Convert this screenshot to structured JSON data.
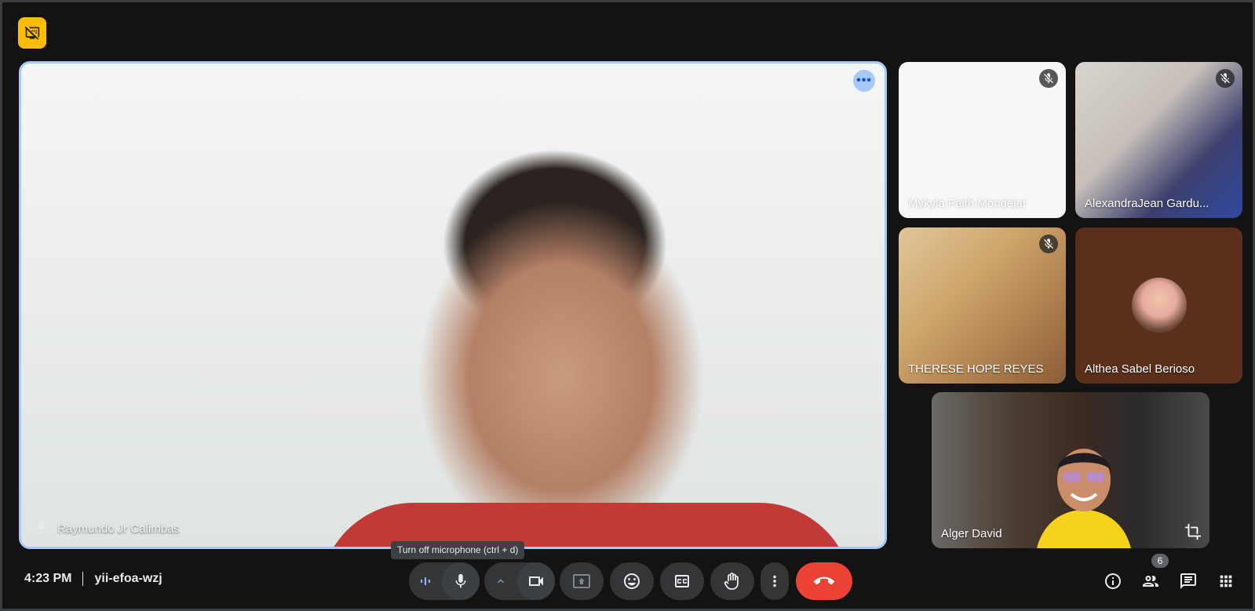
{
  "meeting": {
    "time": "4:23 PM",
    "code": "yii-efoa-wzj"
  },
  "main_tile": {
    "participant": "Raymundo Jr Calimbas"
  },
  "participants": [
    {
      "name": "Mykyla Faith Mondejar",
      "muted": true
    },
    {
      "name": "AlexandraJean Gardu...",
      "muted": true
    },
    {
      "name": "THERESE HOPE REYES",
      "muted": true
    },
    {
      "name": "Althea Sabel Berioso",
      "muted": false
    }
  ],
  "self_tile": {
    "name": "Alger David"
  },
  "tooltip": "Turn off microphone (ctrl + d)",
  "people_count": "6",
  "colors": {
    "accent": "#a8c7fa",
    "end_call": "#ea4335",
    "badge": "#fbbc04"
  }
}
